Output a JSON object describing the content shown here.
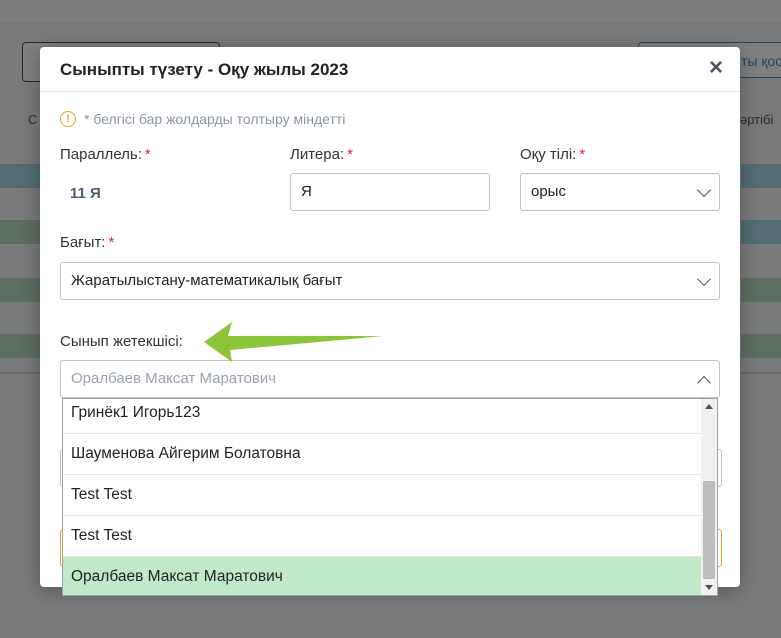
{
  "background": {
    "right_button_label": "ты қос",
    "right_col_header": "әртібі",
    "left_col_header": "С"
  },
  "modal": {
    "title": "Сыныпты түзету - Оқу жылы 2023",
    "close_symbol": "×",
    "required_notice": "* белгісі бар жолдарды толтыру міндетті",
    "info_symbol": "!",
    "required_mark": "*",
    "parallel": {
      "label": "Параллель:",
      "value": "11 Я"
    },
    "litera": {
      "label": "Литера:",
      "value": "Я"
    },
    "language": {
      "label": "Оқу тілі:",
      "value": "орыс"
    },
    "direction": {
      "label": "Бағыт:",
      "value": "Жаратылыстану-математикалық бағыт"
    },
    "class_teacher": {
      "label": "Сынып жетекшісі:",
      "placeholder": "Оралбаев Максат Маратович",
      "options": [
        "Гринёк1 Игорь123",
        "Шауменова Айгерим Болатовна",
        "Test Test",
        "Test Test",
        "Оралбаев Максат Маратович"
      ],
      "selected_index": 4
    }
  },
  "colors": {
    "selected_option": "#bfe9c8",
    "required": "#e0243a",
    "info": "#f0a020",
    "annotation_arrow": "#8cc43c"
  }
}
